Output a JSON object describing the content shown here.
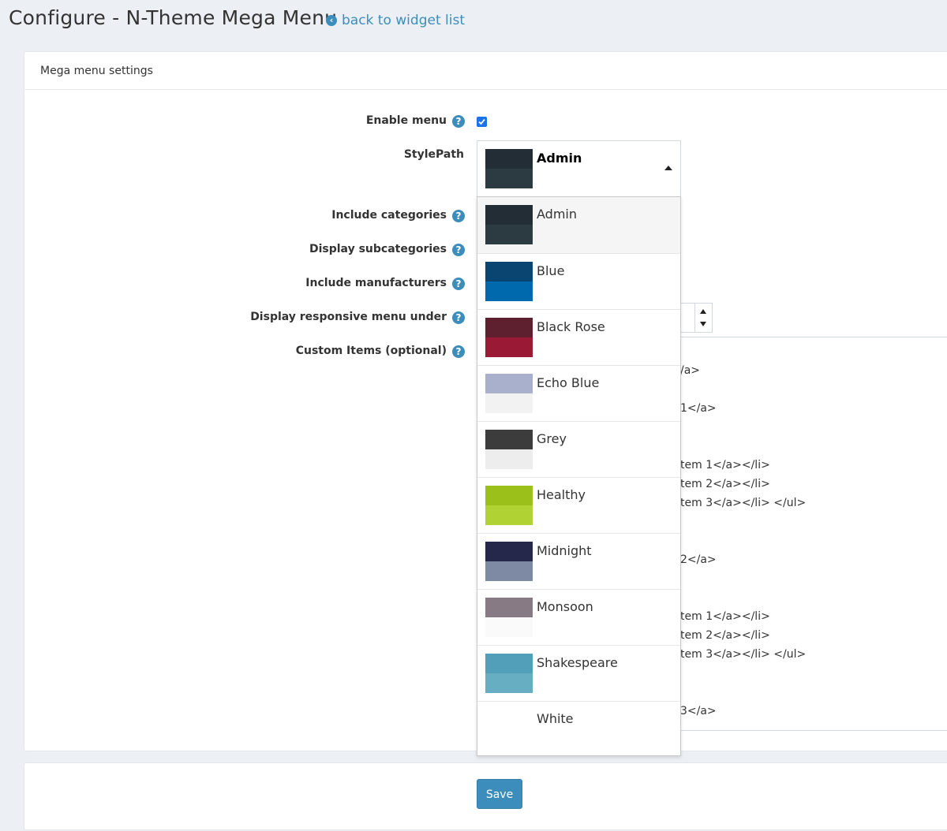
{
  "header": {
    "title": "Configure - N-Theme Mega Menu",
    "back_link": "back to widget list"
  },
  "settings_card": {
    "title": "Mega menu settings",
    "fields": {
      "enable_menu": {
        "label": "Enable menu",
        "checked": true
      },
      "style_path": {
        "label": "StylePath",
        "selected": "Admin"
      },
      "include_categories": {
        "label": "Include categories"
      },
      "display_subcategories": {
        "label": "Display subcategories"
      },
      "include_manufacturers": {
        "label": "Include manufacturers"
      },
      "display_responsive_under": {
        "label": "Display responsive menu under"
      },
      "custom_items": {
        "label": "Custom Items (optional)"
      }
    }
  },
  "style_options": [
    {
      "label": "Admin",
      "top_color": "#232d35",
      "bottom_color": "#2c3a42"
    },
    {
      "label": "Blue",
      "top_color": "#0a4571",
      "bottom_color": "#0069ad"
    },
    {
      "label": "Black Rose",
      "top_color": "#5e1f2e",
      "bottom_color": "#9a1a36"
    },
    {
      "label": "Echo Blue",
      "top_color": "#a9b0cc",
      "bottom_color": "#f2f2f2"
    },
    {
      "label": "Grey",
      "top_color": "#3c3c3c",
      "bottom_color": "#ededed"
    },
    {
      "label": "Healthy",
      "top_color": "#9ac019",
      "bottom_color": "#b0d233"
    },
    {
      "label": "Midnight",
      "top_color": "#25284a",
      "bottom_color": "#7e8aa4"
    },
    {
      "label": "Monsoon",
      "top_color": "#877a84",
      "bottom_color": "#fafafa"
    },
    {
      "label": "Shakespeare",
      "top_color": "#519fb8",
      "bottom_color": "#67aec2"
    },
    {
      "label": "White",
      "top_color": "#ffffff",
      "bottom_color": "#ffffff"
    }
  ],
  "custom_items_snippets": [
    "/a>",
    "1</a>",
    "tem 1</a></li>",
    "tem 2</a></li>",
    "tem 3</a></li> </ul>",
    "2</a>",
    "tem 1</a></li>",
    "tem 2</a></li>",
    "tem 3</a></li> </ul>",
    "3</a>"
  ],
  "save_card": {
    "save_label": "Save"
  },
  "colors": {
    "accent": "#3c8dbc",
    "background": "#ecf0f5"
  }
}
